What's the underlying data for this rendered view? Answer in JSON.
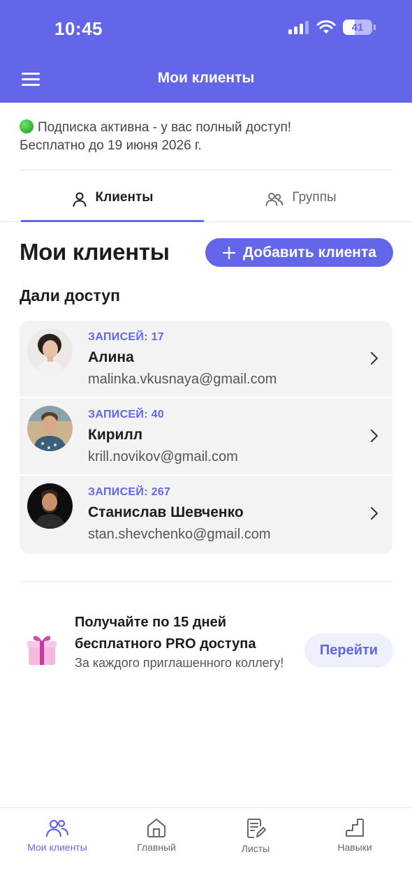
{
  "status_bar": {
    "time": "10:45",
    "battery": "41"
  },
  "header": {
    "title": "Мои клиенты"
  },
  "subscription": {
    "line1": "Подписка активна - у вас полный доступ!",
    "line2": "Бесплатно до 19 июня 2026 г."
  },
  "tabs": [
    {
      "label": "Клиенты",
      "active": true
    },
    {
      "label": "Группы",
      "active": false
    }
  ],
  "main": {
    "title": "Мои клиенты",
    "add_button": "Добавить клиента",
    "section_title": "Дали доступ"
  },
  "clients": [
    {
      "records": "ЗАПИСЕЙ: 17",
      "name": "Алина",
      "email": "malinka.vkusnaya@gmail.com"
    },
    {
      "records": "ЗАПИСЕЙ: 40",
      "name": "Кирилл",
      "email": "krill.novikov@gmail.com"
    },
    {
      "records": "ЗАПИСЕЙ: 267",
      "name": "Станислав Шевченко",
      "email": "stan.shevchenko@gmail.com"
    }
  ],
  "promo": {
    "title": "Получайте по 15 дней бесплатного PRO доступа",
    "subtitle": "За каждого приглашенного коллегу!",
    "button": "Перейти"
  },
  "tabbar": [
    {
      "label": "Мои клиенты",
      "icon": "people-icon",
      "active": true
    },
    {
      "label": "Главный",
      "icon": "home-icon",
      "active": false
    },
    {
      "label": "Листы",
      "icon": "document-edit-icon",
      "active": false
    },
    {
      "label": "Навыки",
      "icon": "steps-icon",
      "active": false
    }
  ],
  "colors": {
    "accent": "#6466e9",
    "card": "#f3f3f4",
    "promo_button_bg": "#eef0fb"
  }
}
